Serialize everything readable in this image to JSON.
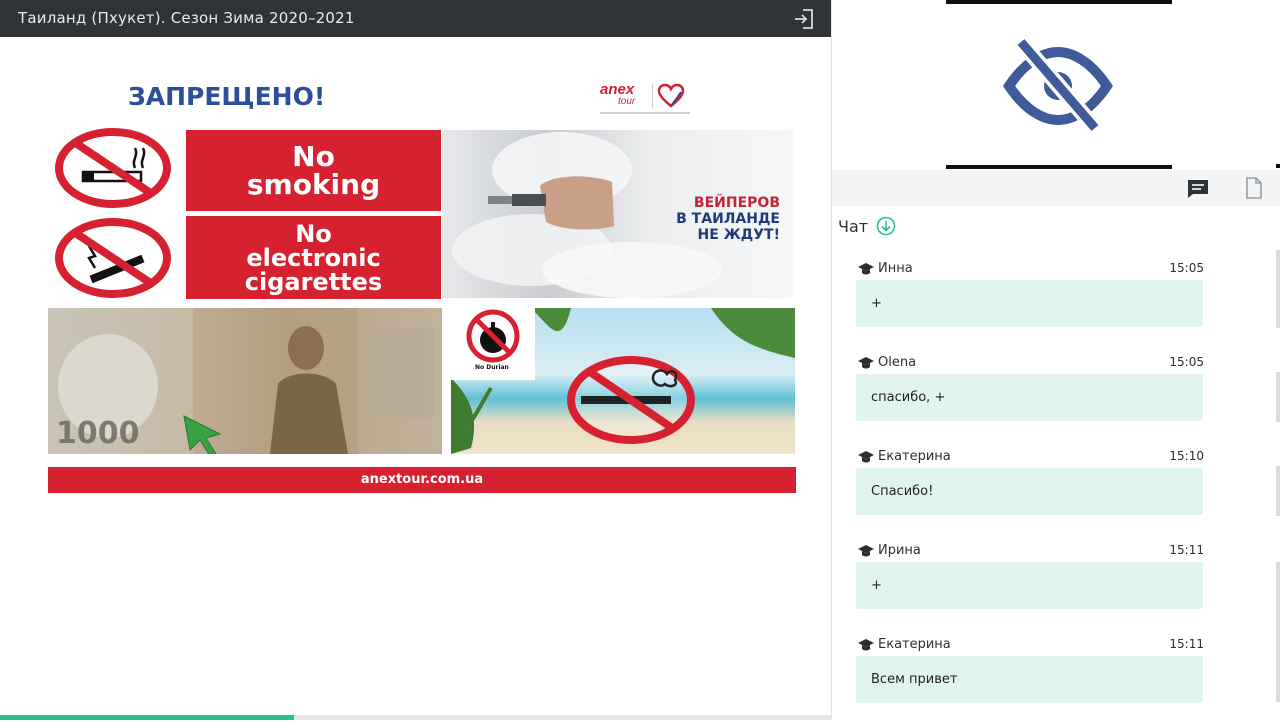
{
  "topbar": {
    "title": "Таиланд (Пхукет). Сезон Зима 2020–2021",
    "exit_icon": "exit-icon"
  },
  "slide": {
    "heading": "ЗАПРЕЩЕНО!",
    "logo": {
      "anex": "anex",
      "tour": "tour"
    },
    "banner1": {
      "line1": "No",
      "line2": "smoking"
    },
    "banner2": {
      "line1": "No",
      "line2": "electronic",
      "line3": "cigarettes"
    },
    "vape_text": {
      "line1": "ВЕЙПЕРОВ",
      "line2": "В ТАИЛАНДЕ",
      "line3": "НЕ ЖДУТ!"
    },
    "durian_label": "No Durian",
    "banknote_value": "1000",
    "footer": "anextour.com.ua",
    "colors": {
      "red": "#d62130",
      "blue": "#2d4f9a"
    }
  },
  "progress": {
    "fraction": 0.23,
    "color": "#2bbf8d"
  },
  "panel": {
    "tabs": {
      "chat_icon": "chat-bubble-icon",
      "files_icon": "document-icon"
    },
    "chat_title": "Чат",
    "messages": [
      {
        "author": "Инна",
        "time": "15:05",
        "text": "+"
      },
      {
        "author": "Olena",
        "time": "15:05",
        "text": "спасибо, +"
      },
      {
        "author": "Екатерина",
        "time": "15:10",
        "text": "Спасибо!"
      },
      {
        "author": "Ирина",
        "time": "15:11",
        "text": "+"
      },
      {
        "author": "Екатерина",
        "time": "15:11",
        "text": "Всем привет"
      }
    ],
    "bubble_color": "#e0f5ee"
  }
}
